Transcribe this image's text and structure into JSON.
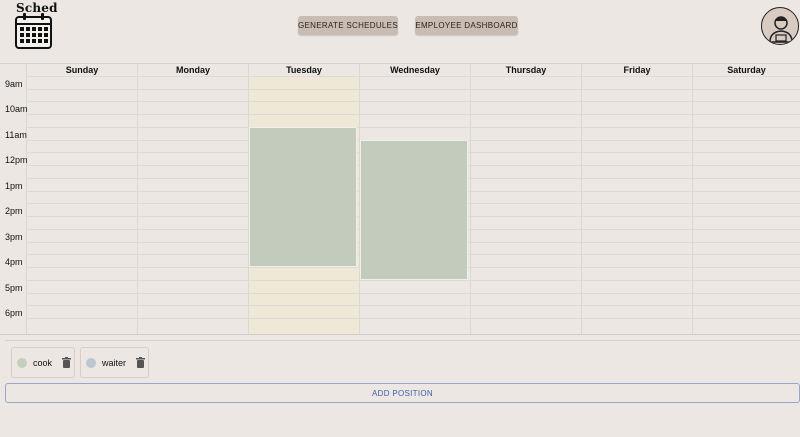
{
  "header": {
    "logo_text": "Sched",
    "generate_label": "GENERATE SCHEDULES",
    "dashboard_label": "EMPLOYEE DASHBOARD"
  },
  "calendar": {
    "days": [
      "Sunday",
      "Monday",
      "Tuesday",
      "Wednesday",
      "Thursday",
      "Friday",
      "Saturday"
    ],
    "times": [
      "9am",
      "10am",
      "11am",
      "12pm",
      "1pm",
      "2pm",
      "3pm",
      "4pm",
      "5pm",
      "6pm"
    ],
    "highlighted_day": "Tuesday",
    "highlight_color": "#f0e8d6",
    "shift_color": "#c3ccbc"
  },
  "positions": [
    {
      "name": "cook",
      "color": "#c3d0bd"
    },
    {
      "name": "waiter",
      "color": "#bcc5d0"
    }
  ],
  "add_position_label": "ADD POSITION"
}
